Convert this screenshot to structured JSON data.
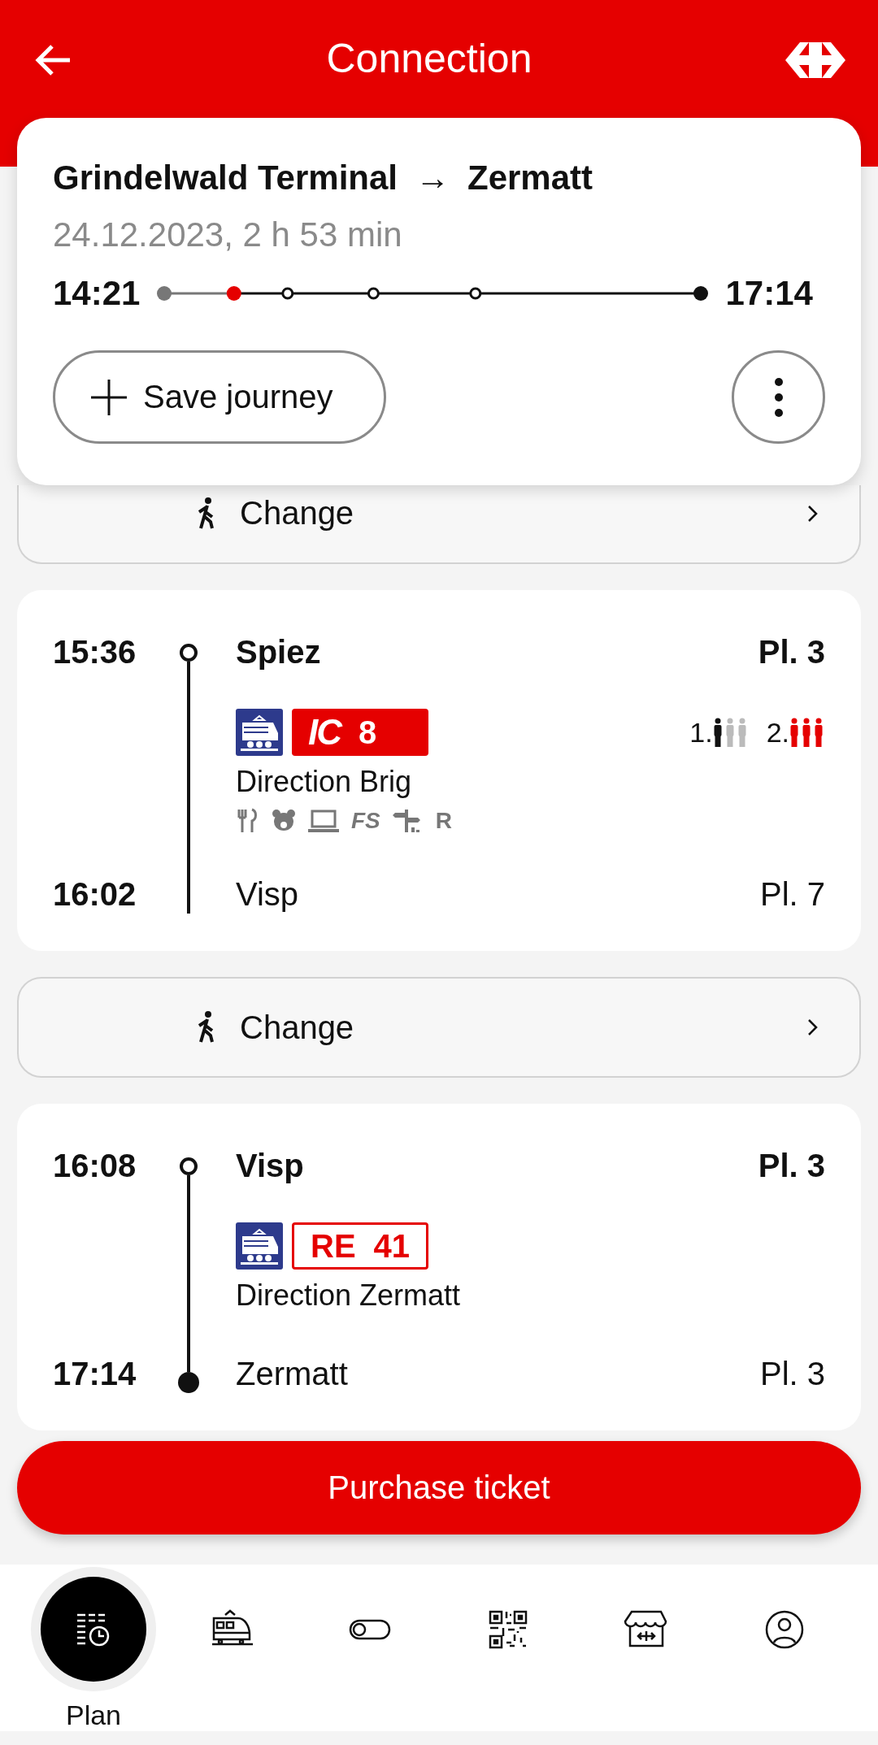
{
  "header": {
    "title": "Connection"
  },
  "summary": {
    "origin": "Grindelwald Terminal",
    "arrow": "→",
    "destination": "Zermatt",
    "date_duration": "24.12.2023, 2 h 53 min",
    "departure": "14:21",
    "arrival": "17:14",
    "stops": [
      {
        "kind": "past"
      },
      {
        "kind": "current"
      },
      {
        "kind": "stop"
      },
      {
        "kind": "stop"
      },
      {
        "kind": "stop"
      },
      {
        "kind": "end"
      }
    ],
    "save_button": "Save journey"
  },
  "sections": [
    {
      "kind": "change",
      "label": "Change"
    },
    {
      "kind": "leg",
      "dep_time": "15:36",
      "dep_station": "Spiez",
      "dep_platform": "Pl. 3",
      "product": {
        "kind": "ic",
        "name": "IC",
        "line": "8"
      },
      "direction": "Direction Brig",
      "occupancy": [
        {
          "label": "1.",
          "kind": "low"
        },
        {
          "label": "2.",
          "kind": "high"
        }
      ],
      "attributes": [
        {
          "kind": "restaurant"
        },
        {
          "kind": "family"
        },
        {
          "kind": "laptop"
        },
        {
          "kind": "text",
          "text": "FS"
        },
        {
          "kind": "sign"
        },
        {
          "kind": "text",
          "text": "R"
        }
      ],
      "arr_time": "16:02",
      "arr_station": "Visp",
      "arr_platform": "Pl. 7",
      "final": false
    },
    {
      "kind": "change",
      "label": "Change"
    },
    {
      "kind": "leg",
      "dep_time": "16:08",
      "dep_station": "Visp",
      "dep_platform": "Pl. 3",
      "product": {
        "kind": "re",
        "name": "RE",
        "line": "41"
      },
      "direction": "Direction Zermatt",
      "arr_time": "17:14",
      "arr_station": "Zermatt",
      "arr_platform": "Pl. 3",
      "final": true
    }
  ],
  "purchase_button": "Purchase ticket",
  "nav": [
    {
      "kind": "plan",
      "label": "Plan",
      "selected": true
    },
    {
      "kind": "train",
      "selected": false
    },
    {
      "kind": "toggle",
      "selected": false
    },
    {
      "kind": "qr",
      "selected": false
    },
    {
      "kind": "shop",
      "selected": false
    },
    {
      "kind": "profile",
      "selected": false
    }
  ]
}
